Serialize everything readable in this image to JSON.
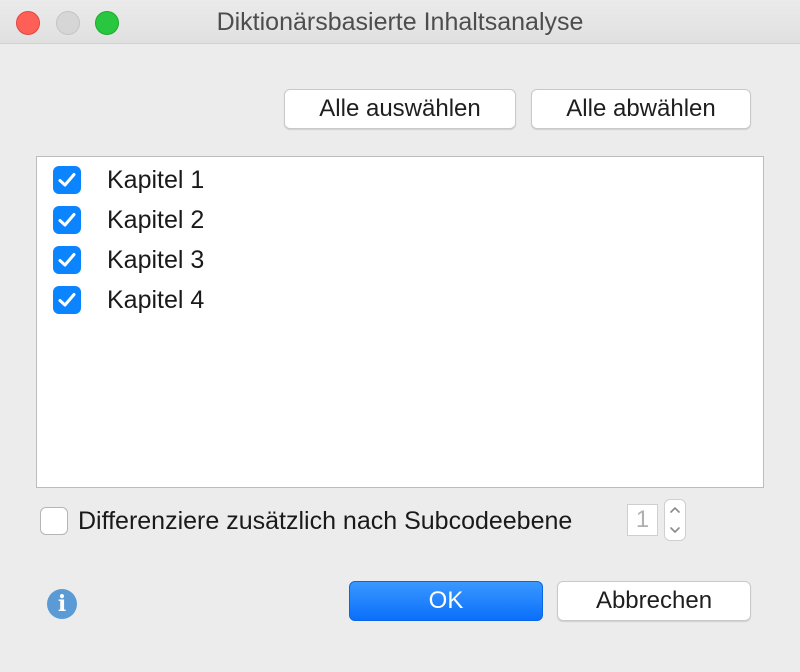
{
  "window": {
    "title": "Diktionärsbasierte Inhaltsanalyse"
  },
  "toolbar": {
    "select_all_label": "Alle auswählen",
    "deselect_all_label": "Alle abwählen"
  },
  "document_list": {
    "items": [
      {
        "label": "Kapitel 1",
        "checked": true
      },
      {
        "label": "Kapitel 2",
        "checked": true
      },
      {
        "label": "Kapitel 3",
        "checked": true
      },
      {
        "label": "Kapitel 4",
        "checked": true
      }
    ]
  },
  "options": {
    "subcode_label": "Differenziere zusätzlich nach Subcodeebene",
    "subcode_checked": false,
    "subcode_level": "1"
  },
  "footer": {
    "info_glyph": "i",
    "ok_label": "OK",
    "cancel_label": "Abbrechen"
  },
  "colors": {
    "accent": "#0a84ff",
    "close": "#fe5f57",
    "zoom": "#29c740",
    "info": "#5b9bd5"
  },
  "icons": {
    "close": "close-icon",
    "minimize": "minimize-icon",
    "zoom": "zoom-icon",
    "checkmark": "checkmark-icon",
    "info": "info-icon",
    "stepper_up": "chevron-up-icon",
    "stepper_down": "chevron-down-icon"
  }
}
